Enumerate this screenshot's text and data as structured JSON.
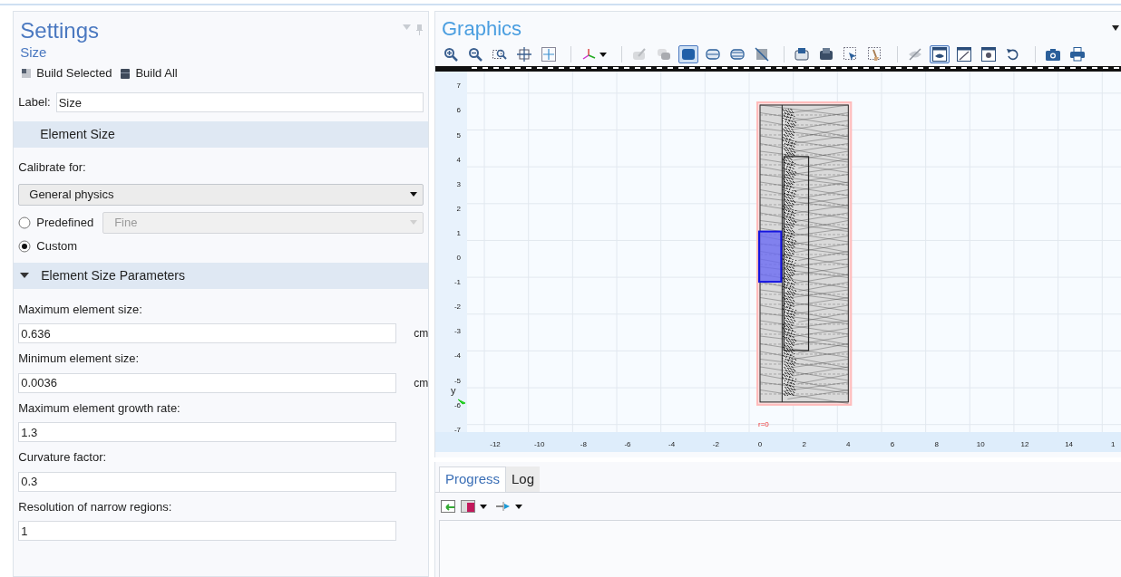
{
  "settings": {
    "title": "Settings",
    "subtitle": "Size",
    "build_buttons": [
      {
        "label": "Build Selected"
      },
      {
        "label": "Build All"
      }
    ],
    "label_field": {
      "label": "Label:",
      "value": "Size"
    },
    "element_size": {
      "header": "Element Size",
      "calibrate_label": "Calibrate for:",
      "calibrate_value": "General physics",
      "options": [
        {
          "label": "Predefined",
          "selected": false,
          "value": "Fine"
        },
        {
          "label": "Custom",
          "selected": true
        }
      ]
    },
    "parameters": {
      "header": "Element Size Parameters",
      "expanded": true,
      "fields": [
        {
          "label": "Maximum element size:",
          "value": "0.636",
          "unit": "cm"
        },
        {
          "label": "Minimum element size:",
          "value": "0.0036",
          "unit": "cm"
        },
        {
          "label": "Maximum element growth rate:",
          "value": "1.3"
        },
        {
          "label": "Curvature factor:",
          "value": "0.3"
        },
        {
          "label": "Resolution of narrow regions:",
          "value": "1"
        }
      ]
    }
  },
  "graphics": {
    "title": "Graphics",
    "toolbar_groups": [
      [
        {
          "selected": false,
          "dropdown": false
        },
        {
          "selected": false,
          "dropdown": false
        },
        {
          "selected": false,
          "dropdown": false
        },
        {
          "selected": false,
          "dropdown": false
        },
        {
          "selected": false,
          "dropdown": false
        }
      ],
      [
        {
          "selected": false,
          "dropdown": true
        }
      ],
      [
        {
          "selected": false,
          "dropdown": false
        },
        {
          "selected": false,
          "dropdown": false
        },
        {
          "selected": true,
          "dropdown": false
        },
        {
          "selected": false,
          "dropdown": false
        },
        {
          "selected": false,
          "dropdown": false
        },
        {
          "selected": false,
          "dropdown": false
        }
      ],
      [
        {
          "selected": false,
          "dropdown": false
        },
        {
          "selected": false,
          "dropdown": false
        },
        {
          "selected": false,
          "dropdown": false
        },
        {
          "selected": false,
          "dropdown": false
        }
      ],
      [
        {
          "selected": false,
          "dropdown": false
        },
        {
          "selected": true,
          "dropdown": false
        },
        {
          "selected": false,
          "dropdown": false
        },
        {
          "selected": false,
          "dropdown": false
        },
        {
          "selected": false,
          "dropdown": false
        }
      ],
      [
        {
          "selected": false,
          "dropdown": false
        },
        {
          "selected": false,
          "dropdown": false
        }
      ]
    ],
    "plot": {
      "x_ticks": [
        "-12",
        "-10",
        "-8",
        "-6",
        "-4",
        "-2",
        "0",
        "2",
        "4",
        "6",
        "8",
        "10",
        "12",
        "14",
        "1"
      ],
      "y_ticks": [
        "7",
        "6",
        "5",
        "4",
        "3",
        "2",
        "1",
        "0",
        "-1",
        "-2",
        "-3",
        "-4",
        "-5",
        "-6",
        "-7"
      ],
      "axis_label": "y",
      "boundary_label": "r=0"
    }
  },
  "messages": {
    "tabs": [
      {
        "label": "Progress",
        "selected": true
      },
      {
        "label": "Log",
        "selected": false
      }
    ]
  }
}
